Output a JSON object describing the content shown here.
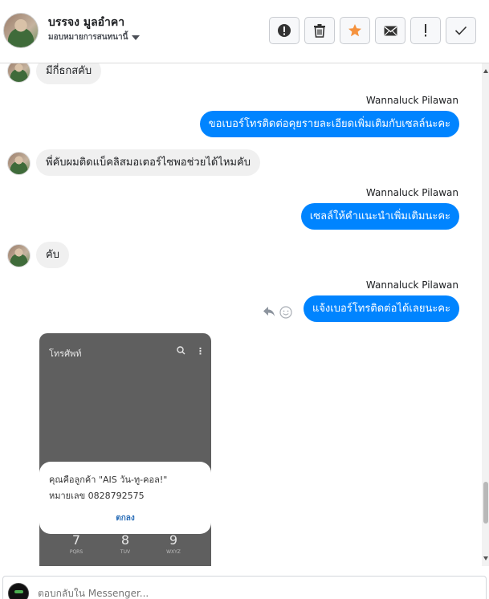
{
  "header": {
    "contact_name": "บรรจง มูลอำคา",
    "assignee": "มอบหมายการสนทนานี้",
    "toolbar": [
      {
        "name": "report-spam-button",
        "icon": "alert-circle-icon"
      },
      {
        "name": "delete-button",
        "icon": "trash-icon"
      },
      {
        "name": "star-button",
        "icon": "star-icon"
      },
      {
        "name": "mark-unread-button",
        "icon": "envelope-icon"
      },
      {
        "name": "follow-up-button",
        "icon": "exclamation-icon"
      },
      {
        "name": "mark-done-button",
        "icon": "checkmark-icon"
      }
    ],
    "accent_star": "#f5923e"
  },
  "messages": {
    "m1": "มีกี่ธกสคับ",
    "s1": "Wannaluck Pilawan",
    "m2": "ขอเบอร์โทรติดต่อคุยรายละเอียดเพิ่มเติมกับเซลล์นะคะ",
    "m3": "พี่คับผมติดแบ็คลิสมอเตอร์ไซพอช่วยได้ไหมคับ",
    "s2": "Wannaluck Pilawan",
    "m4": "เซลล์ให้คำแนะนำเพิ่มเติมนะคะ",
    "m5": "คับ",
    "s3": "Wannaluck Pilawan",
    "m6": "แจ้งเบอร์โทรติดต่อได้เลยนะคะ"
  },
  "attachment": {
    "title": "โทรศัพท์",
    "dialog_line1": "คุณคือลูกค้า \"AIS วัน-ทู-คอล!\"",
    "dialog_line2": "หมายเลข 0828792575",
    "ok": "ตกลง",
    "keys": [
      {
        "num": "7",
        "sub": "PQRS"
      },
      {
        "num": "8",
        "sub": "TUV"
      },
      {
        "num": "9",
        "sub": "WXYZ"
      }
    ]
  },
  "composer": {
    "placeholder": "ตอบกลับใน Messenger..."
  },
  "colors": {
    "outgoing_bubble": "#0084ff",
    "incoming_bubble": "#f0f0f0"
  }
}
